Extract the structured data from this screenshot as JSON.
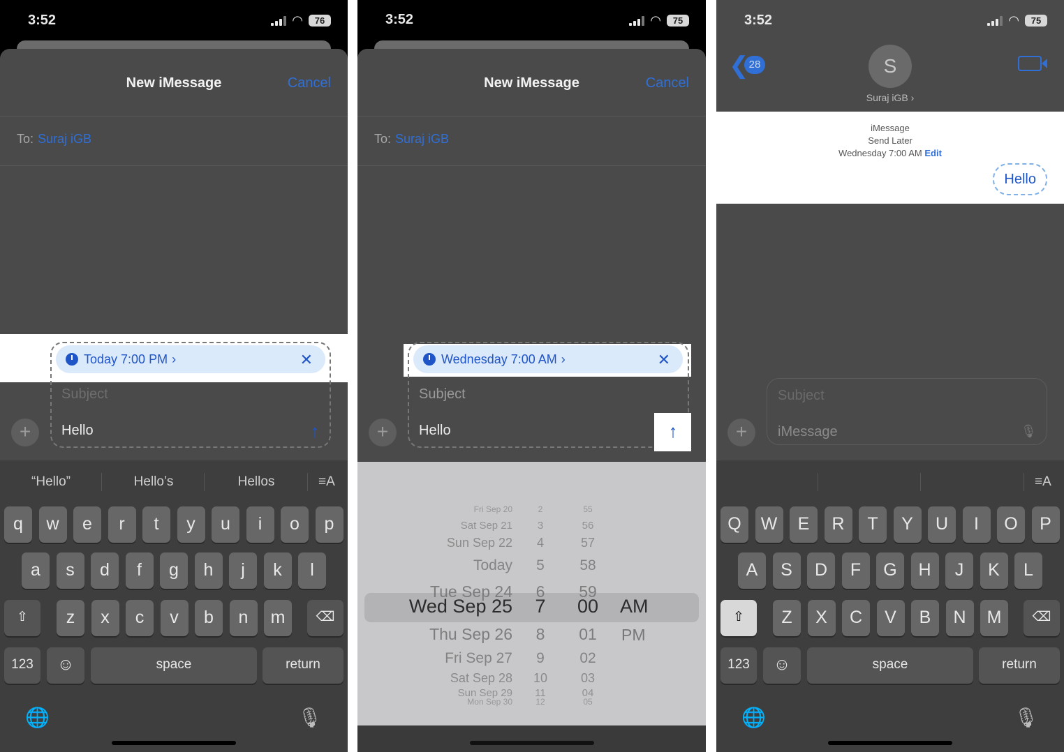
{
  "colors": {
    "accent": "#2f6fd6",
    "highlight": "#ffffff",
    "pill": "#dbeafb"
  },
  "panel1": {
    "status": {
      "time": "3:52",
      "battery": "76"
    },
    "nav": {
      "title": "New iMessage",
      "cancel": "Cancel"
    },
    "to": {
      "label": "To:",
      "name": "Suraj iGB"
    },
    "schedule_pill": {
      "label": "Today 7:00 PM",
      "chevron": "›",
      "close": "✕"
    },
    "compose": {
      "subject_placeholder": "Subject",
      "message": "Hello"
    },
    "suggestions": [
      "“Hello”",
      "Hello’s",
      "Hellos"
    ],
    "keyboard": {
      "row1": [
        "q",
        "w",
        "e",
        "r",
        "t",
        "y",
        "u",
        "i",
        "o",
        "p"
      ],
      "row2": [
        "a",
        "s",
        "d",
        "f",
        "g",
        "h",
        "j",
        "k",
        "l"
      ],
      "row3": [
        "z",
        "x",
        "c",
        "v",
        "b",
        "n",
        "m"
      ],
      "numbers": "123",
      "space": "space",
      "return": "return"
    }
  },
  "panel2": {
    "status": {
      "time": "3:52",
      "battery": "75"
    },
    "nav": {
      "title": "New iMessage",
      "cancel": "Cancel"
    },
    "to": {
      "label": "To:",
      "name": "Suraj iGB"
    },
    "schedule_pill": {
      "label": "Wednesday 7:00 AM",
      "chevron": "›",
      "close": "✕"
    },
    "compose": {
      "subject_placeholder": "Subject",
      "message": "Hello"
    },
    "picker": {
      "days": [
        "Fri Sep 20",
        "Sat Sep 21",
        "Sun Sep 22",
        "Today",
        "Tue Sep 24",
        "Wed Sep 25",
        "Thu Sep 26",
        "Fri Sep 27",
        "Sat Sep 28",
        "Sun Sep 29",
        "Mon Sep 30"
      ],
      "hours": [
        "2",
        "3",
        "4",
        "5",
        "6",
        "7",
        "8",
        "9",
        "10",
        "11",
        "12"
      ],
      "minutes": [
        "55",
        "56",
        "57",
        "58",
        "59",
        "00",
        "01",
        "02",
        "03",
        "04",
        "05"
      ],
      "periods": [
        "AM",
        "PM"
      ],
      "selected_index": 5
    }
  },
  "panel3": {
    "status": {
      "time": "3:52",
      "battery": "75"
    },
    "header": {
      "back_count": "28",
      "avatar_letter": "S",
      "contact": "Suraj iGB",
      "contact_chevron": "›"
    },
    "thread": {
      "service": "iMessage",
      "send_later": "Send Later",
      "scheduled": "Wednesday 7:00 AM",
      "edit": "Edit",
      "bubble": "Hello"
    },
    "compose": {
      "subject_placeholder": "Subject",
      "message_placeholder": "iMessage"
    },
    "keyboard": {
      "row1": [
        "Q",
        "W",
        "E",
        "R",
        "T",
        "Y",
        "U",
        "I",
        "O",
        "P"
      ],
      "row2": [
        "A",
        "S",
        "D",
        "F",
        "G",
        "H",
        "J",
        "K",
        "L"
      ],
      "row3": [
        "Z",
        "X",
        "C",
        "V",
        "B",
        "N",
        "M"
      ],
      "numbers": "123",
      "space": "space",
      "return": "return"
    }
  },
  "icons": {
    "format": "≡A",
    "shift": "⇧",
    "delete": "⌫",
    "emoji": "☺",
    "globe": "🌐",
    "mic": "🎙",
    "send": "↑",
    "plus": "+",
    "back": "❮"
  }
}
